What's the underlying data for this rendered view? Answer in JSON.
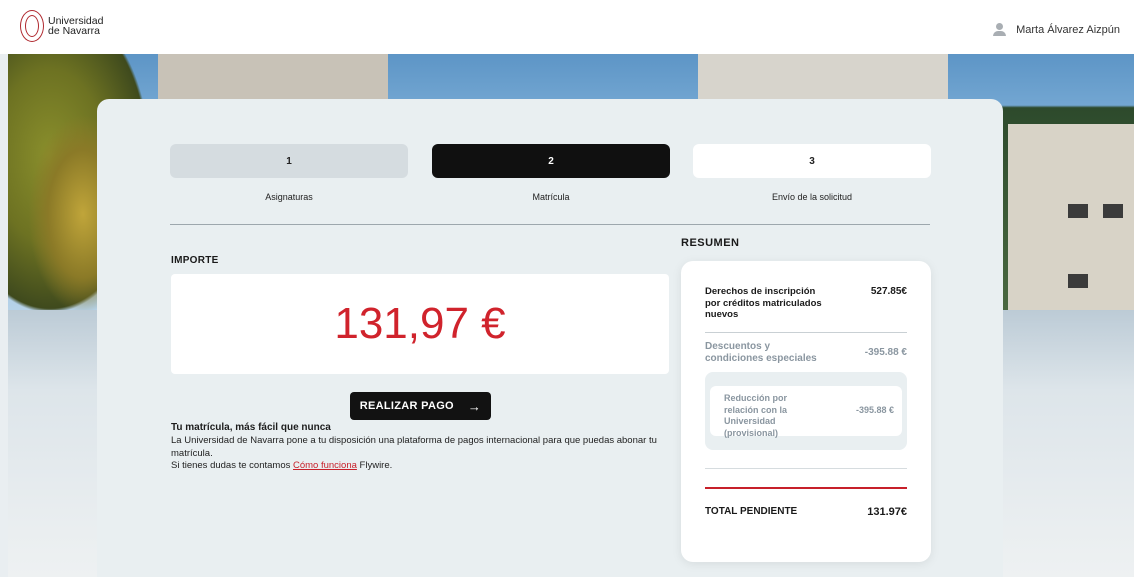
{
  "header": {
    "logo_line1": "Universidad",
    "logo_line2": "de Navarra",
    "user_name": "Marta Álvarez Aizpún"
  },
  "steps": [
    {
      "number": "1",
      "label": "Asignaturas",
      "state": "completed"
    },
    {
      "number": "2",
      "label": "Matrícula",
      "state": "active"
    },
    {
      "number": "3",
      "label": "Envío de la solicitud",
      "state": "pending"
    }
  ],
  "importe": {
    "title": "IMPORTE",
    "amount": "131,97 €",
    "pay_button": "REALIZAR PAGO",
    "info_title": "Tu matrícula, más fácil que nunca",
    "info_text": "La Universidad de Navarra pone a tu disposición una plataforma de pagos internacional para que puedas abonar tu matrícula.",
    "help_prefix": "Si tienes dudas te contamos ",
    "help_link": "Cómo funciona",
    "help_suffix": " Flywire."
  },
  "resumen": {
    "title": "RESUMEN",
    "derechos_label": "Derechos de inscripción por créditos matriculados nuevos",
    "derechos_value": "527.85€",
    "descuentos_label": "Descuentos y condiciones especiales",
    "descuentos_value": "-395.88 €",
    "reduccion_label": "Reducción por relación con la Universidad (provisional)",
    "reduccion_value": "-395.88 €",
    "total_label": "TOTAL PENDIENTE",
    "total_value": "131.97€"
  },
  "colors": {
    "accent_red": "#c7202a",
    "step_active": "#101010",
    "step_done": "#d5dce0"
  },
  "icons": {
    "user": "user-icon",
    "arrow": "arrow-right-icon",
    "logo": "university-seal-icon"
  }
}
